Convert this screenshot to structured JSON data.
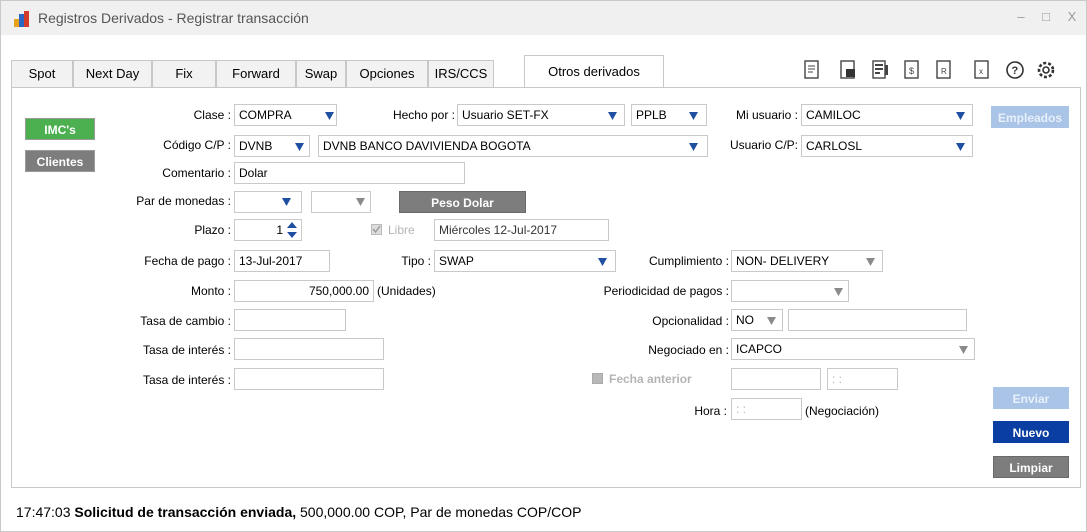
{
  "window": {
    "title": "Registros Derivados - Registrar transacción",
    "controls": [
      "–",
      "□",
      "X"
    ]
  },
  "tabs": [
    {
      "label": "Spot",
      "active": false
    },
    {
      "label": "Next Day",
      "active": false
    },
    {
      "label": "Fix",
      "active": false
    },
    {
      "label": "Forward",
      "active": false
    },
    {
      "label": "Swap",
      "active": false
    },
    {
      "label": "Opciones",
      "active": false
    },
    {
      "label": "IRS/CCS",
      "active": false
    },
    {
      "label": "Otros derivados",
      "active": true
    }
  ],
  "toolbar_icons": [
    "document-icon",
    "lb-document-icon",
    "report-icon",
    "dollar-document-icon",
    "r-document-icon",
    "x-document-icon",
    "help-icon",
    "gear-icon"
  ],
  "side_buttons": {
    "imcs": "IMC's",
    "clientes": "Clientes"
  },
  "form": {
    "clase_label": "Clase :",
    "clase_value": "COMPRA",
    "hecho_por_label": "Hecho por :",
    "hecho_por_value": "Usuario SET-FX",
    "hecho_por_code": "PPLB",
    "mi_usuario_label": "Mi usuario :",
    "mi_usuario_value": "CAMILOC",
    "codigo_cp_label": "Código C/P :",
    "codigo_cp_value": "DVNB",
    "codigo_cp_name": "DVNB BANCO DAVIVIENDA  BOGOTA",
    "usuario_cp_label": "Usuario C/P:",
    "usuario_cp_value": "CARLOSL",
    "comentario_label": "Comentario :",
    "comentario_value": "Dolar",
    "par_monedas_label": "Par de monedas :",
    "par_monedas_1": "",
    "par_monedas_2": "",
    "peso_dolar_button": "Peso Dolar",
    "plazo_label": "Plazo :",
    "plazo_value": "1",
    "libre_label": "Libre",
    "libre_date": "Miércoles 12-Jul-2017",
    "fecha_pago_label": "Fecha de pago :",
    "fecha_pago_value": "13-Jul-2017",
    "tipo_label": "Tipo :",
    "tipo_value": "SWAP",
    "cumplimiento_label": "Cumplimiento :",
    "cumplimiento_value": "NON- DELIVERY",
    "monto_label": "Monto :",
    "monto_value": "750,000.00",
    "monto_unit": "(Unidades)",
    "periodicidad_label": "Periodicidad de pagos :",
    "periodicidad_value": "",
    "tasa_cambio_label": "Tasa de cambio :",
    "tasa_cambio_value": "",
    "opcionalidad_label": "Opcionalidad :",
    "opcionalidad_value": "NO",
    "opcionalidad_extra": "",
    "tasa_interes_1_label": "Tasa de interés :",
    "tasa_interes_1_value": "",
    "negociado_label": "Negociado en :",
    "negociado_value": "ICAPCO",
    "tasa_interes_2_label": "Tasa de interés :",
    "tasa_interes_2_value": "",
    "fecha_anterior_label": "Fecha anterior",
    "fecha_anterior_date": "",
    "fecha_anterior_time": ": :",
    "hora_label": "Hora :",
    "hora_value": ": :",
    "hora_note": "(Negociación)"
  },
  "right_buttons": {
    "empleados": "Empleados",
    "enviar": "Enviar",
    "nuevo": "Nuevo",
    "limpiar": "Limpiar"
  },
  "status": {
    "time": "17:47:03",
    "message_bold": "Solicitud de transacción enviada,",
    "message_rest": "500,000.00 COP, Par de monedas COP/COP"
  },
  "colors": {
    "green": "#4caf50",
    "navy": "#0b3ea3",
    "gray_button": "#7d7d7d",
    "dropdown_arrow": "#1f4fa0",
    "disabled_button": "#a9c4e6"
  }
}
